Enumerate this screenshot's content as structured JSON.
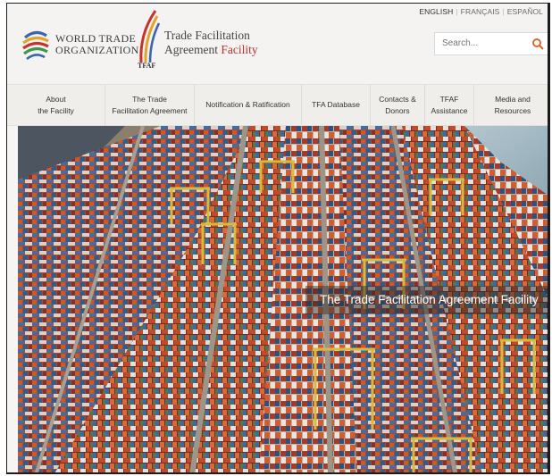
{
  "languages": [
    "ENGLISH",
    "FRANÇAIS",
    "ESPAÑOL"
  ],
  "wto": {
    "line1": "WORLD TRADE",
    "line2": "ORGANIZATION"
  },
  "tfaf": {
    "abbr": "TFAF",
    "line1": "Trade Facilitation",
    "line2a": "Agreement ",
    "line2b": "Facility"
  },
  "search": {
    "placeholder": "Search..."
  },
  "nav": [
    {
      "label": "About\nthe Facility"
    },
    {
      "label": "The Trade\nFacilitation Agreement"
    },
    {
      "label": "Notification & Ratification"
    },
    {
      "label": "TFA Database"
    },
    {
      "label": "Contacts &\nDonors"
    },
    {
      "label": "TFAF\nAssistance"
    },
    {
      "label": "Media and\nResources"
    }
  ],
  "hero": {
    "caption": "The Trade Facilitation Agreement Facility"
  },
  "colors": {
    "accent": "#b8312f",
    "search_icon": "#e0672a",
    "nav_bg": "#f0eeeb"
  }
}
